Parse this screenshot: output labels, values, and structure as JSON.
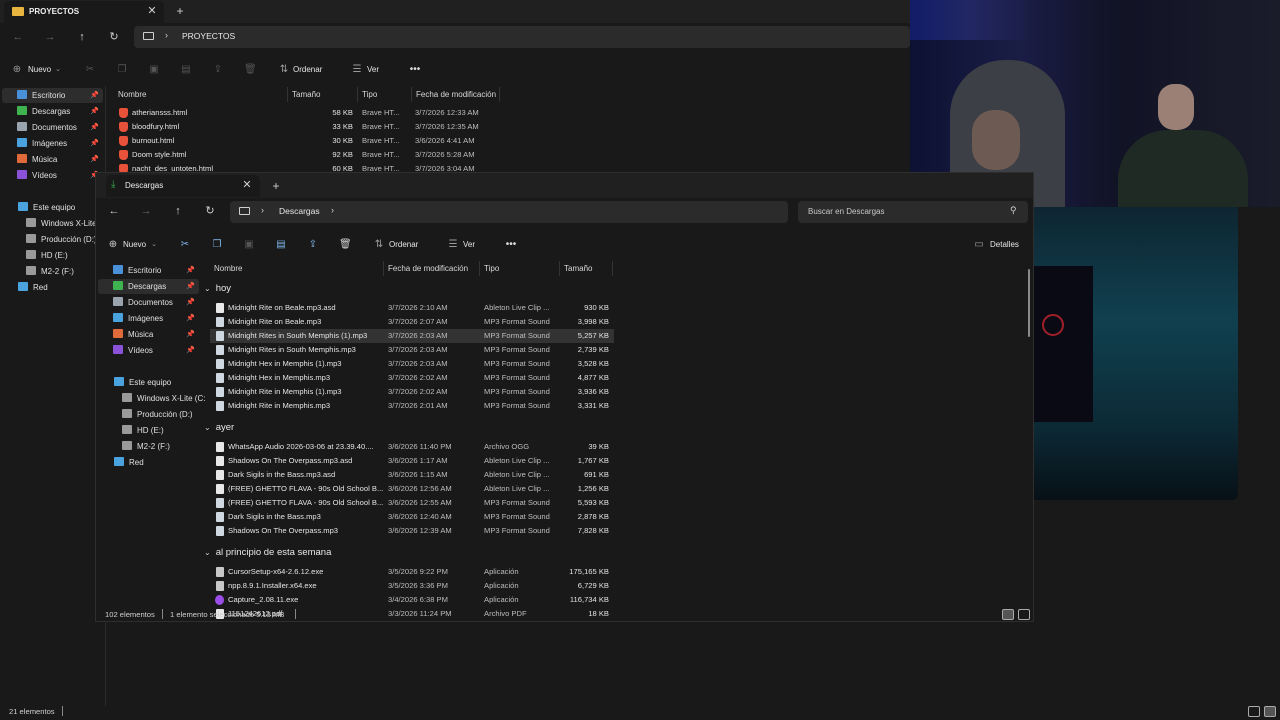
{
  "back_window": {
    "tab_title": "PROYECTOS",
    "breadcrumb": "PROYECTOS",
    "toolbar": {
      "new": "Nuevo",
      "sort": "Ordenar",
      "view": "Ver"
    },
    "columns": {
      "name": "Nombre",
      "size": "Tamaño",
      "type": "Tipo",
      "date": "Fecha de modificación"
    },
    "files": [
      {
        "name": "atheriansss.html",
        "size": "58 KB",
        "type": "Brave HT...",
        "date": "3/7/2026 12:33 AM"
      },
      {
        "name": "bloodfury.html",
        "size": "33 KB",
        "type": "Brave HT...",
        "date": "3/7/2026 12:35 AM"
      },
      {
        "name": "burnout.html",
        "size": "30 KB",
        "type": "Brave HT...",
        "date": "3/6/2026 4:41 AM"
      },
      {
        "name": "Doom style.html",
        "size": "92 KB",
        "type": "Brave HT...",
        "date": "3/7/2026 5:28 AM"
      },
      {
        "name": "nacht_des_untoten.html",
        "size": "60 KB",
        "type": "Brave HT...",
        "date": "3/7/2026 3:04 AM"
      }
    ],
    "sidebar_quick": [
      {
        "label": "Escritorio",
        "pinned": true
      },
      {
        "label": "Descargas",
        "pinned": true
      },
      {
        "label": "Documentos",
        "pinned": true
      },
      {
        "label": "Imágenes",
        "pinned": true
      },
      {
        "label": "Música",
        "pinned": true
      },
      {
        "label": "Vídeos",
        "pinned": true
      }
    ],
    "sidebar_pc": [
      "Este equipo",
      "Windows X-Lite (",
      "Producción (D:)",
      "HD (E:)",
      "M2-2 (F:)",
      "Red"
    ],
    "status": "21 elementos"
  },
  "front_window": {
    "tab_title": "Descargas",
    "breadcrumb": "Descargas",
    "search_placeholder": "Buscar en Descargas",
    "toolbar": {
      "new": "Nuevo",
      "sort": "Ordenar",
      "view": "Ver",
      "details": "Detalles"
    },
    "columns": {
      "name": "Nombre",
      "date": "Fecha de modificación",
      "type": "Tipo",
      "size": "Tamaño"
    },
    "sidebar_quick": [
      {
        "label": "Escritorio"
      },
      {
        "label": "Descargas"
      },
      {
        "label": "Documentos"
      },
      {
        "label": "Imágenes"
      },
      {
        "label": "Música"
      },
      {
        "label": "Vídeos"
      }
    ],
    "sidebar_pc": [
      "Este equipo",
      "Windows X-Lite (C:",
      "Producción (D:)",
      "HD (E:)",
      "M2-2 (F:)",
      "Red"
    ],
    "groups": [
      {
        "label": "hoy",
        "files": [
          {
            "name": "Midnight Rite on Beale.mp3.asd",
            "date": "3/7/2026 2:10 AM",
            "type": "Ableton Live Clip ...",
            "size": "930 KB",
            "icon": "doc"
          },
          {
            "name": "Midnight Rite on Beale.mp3",
            "date": "3/7/2026 2:07 AM",
            "type": "MP3 Format Sound",
            "size": "3,998 KB",
            "icon": "audio"
          },
          {
            "name": "Midnight Rites in South Memphis (1).mp3",
            "date": "3/7/2026 2:03 AM",
            "type": "MP3 Format Sound",
            "size": "5,257 KB",
            "icon": "audio",
            "selected": true
          },
          {
            "name": "Midnight Rites in South Memphis.mp3",
            "date": "3/7/2026 2:03 AM",
            "type": "MP3 Format Sound",
            "size": "2,739 KB",
            "icon": "audio"
          },
          {
            "name": "Midnight Hex in Memphis (1).mp3",
            "date": "3/7/2026 2:03 AM",
            "type": "MP3 Format Sound",
            "size": "3,528 KB",
            "icon": "audio"
          },
          {
            "name": "Midnight Hex in Memphis.mp3",
            "date": "3/7/2026 2:02 AM",
            "type": "MP3 Format Sound",
            "size": "4,877 KB",
            "icon": "audio"
          },
          {
            "name": "Midnight Rite in Memphis (1).mp3",
            "date": "3/7/2026 2:02 AM",
            "type": "MP3 Format Sound",
            "size": "3,936 KB",
            "icon": "audio"
          },
          {
            "name": "Midnight Rite in Memphis.mp3",
            "date": "3/7/2026 2:01 AM",
            "type": "MP3 Format Sound",
            "size": "3,331 KB",
            "icon": "audio"
          }
        ]
      },
      {
        "label": "ayer",
        "files": [
          {
            "name": "WhatsApp Audio 2026-03-06 at 23.39.40....",
            "date": "3/6/2026 11:40 PM",
            "type": "Archivo OGG",
            "size": "39 KB",
            "icon": "doc"
          },
          {
            "name": "Shadows On The Overpass.mp3.asd",
            "date": "3/6/2026 1:17 AM",
            "type": "Ableton Live Clip ...",
            "size": "1,767 KB",
            "icon": "doc"
          },
          {
            "name": "Dark Sigils in the Bass.mp3.asd",
            "date": "3/6/2026 1:15 AM",
            "type": "Ableton Live Clip ...",
            "size": "691 KB",
            "icon": "doc"
          },
          {
            "name": "(FREE) GHETTO FLAVA - 90s Old School B...",
            "date": "3/6/2026 12:56 AM",
            "type": "Ableton Live Clip ...",
            "size": "1,256 KB",
            "icon": "doc"
          },
          {
            "name": "(FREE) GHETTO FLAVA - 90s Old School B...",
            "date": "3/6/2026 12:55 AM",
            "type": "MP3 Format Sound",
            "size": "5,593 KB",
            "icon": "audio"
          },
          {
            "name": "Dark Sigils in the Bass.mp3",
            "date": "3/6/2026 12:40 AM",
            "type": "MP3 Format Sound",
            "size": "2,878 KB",
            "icon": "audio"
          },
          {
            "name": "Shadows On The Overpass.mp3",
            "date": "3/6/2026 12:39 AM",
            "type": "MP3 Format Sound",
            "size": "7,828 KB",
            "icon": "audio"
          }
        ]
      },
      {
        "label": "al principio de esta semana",
        "files": [
          {
            "name": "CursorSetup-x64-2.6.12.exe",
            "date": "3/5/2026 9:22 PM",
            "type": "Aplicación",
            "size": "175,165 KB",
            "icon": "exe"
          },
          {
            "name": "npp.8.9.1.Installer.x64.exe",
            "date": "3/5/2026 3:36 PM",
            "type": "Aplicación",
            "size": "6,729 KB",
            "icon": "exe"
          },
          {
            "name": "Capture_2.08.11.exe",
            "date": "3/4/2026 6:38 PM",
            "type": "Aplicación",
            "size": "116,734 KB",
            "icon": "capture"
          },
          {
            "name": "1151242612.pdf",
            "date": "3/3/2026 11:24 PM",
            "type": "Archivo PDF",
            "size": "18 KB",
            "icon": "doc"
          }
        ]
      }
    ],
    "status": {
      "count": "102 elementos",
      "selection": "1 elemento seleccionado  5.13 MB"
    }
  },
  "colors": {
    "folder": "#e8b53f",
    "accent": "#60a5e0",
    "brave": "#e8523a",
    "selection": "#333333",
    "background": "#191919"
  }
}
